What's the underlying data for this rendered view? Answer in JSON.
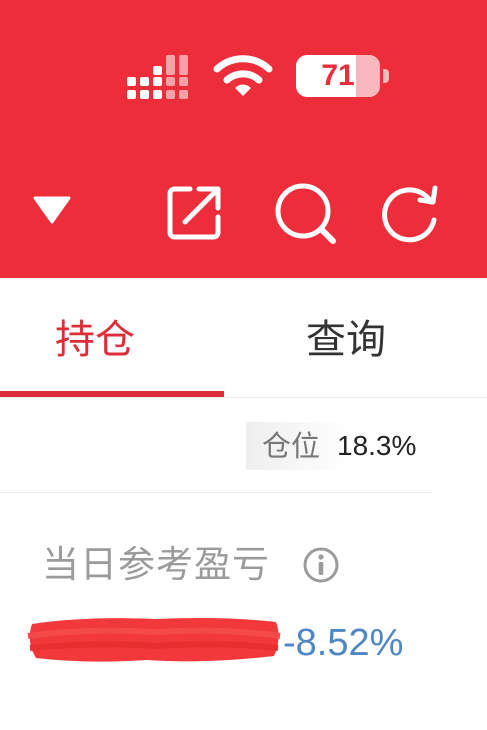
{
  "status_bar": {
    "battery_level": "71",
    "icons": [
      "cellular-signal-icon",
      "wifi-icon",
      "battery-icon"
    ]
  },
  "toolbar": {
    "icons": [
      "dropdown-triangle-icon",
      "share-icon",
      "search-icon",
      "refresh-icon"
    ]
  },
  "tabs": [
    {
      "label": "持仓",
      "active": true
    },
    {
      "label": "查询",
      "active": false
    }
  ],
  "position": {
    "label": "仓位",
    "value": "18.3%"
  },
  "daily_pnl": {
    "title": "当日参考盈亏",
    "percent": "-8.52%"
  },
  "colors": {
    "header_red": "#ee2d3a",
    "active_tab": "#dd2d37",
    "loss_blue": "#4f86c4",
    "muted_text": "#9b9b9b"
  }
}
